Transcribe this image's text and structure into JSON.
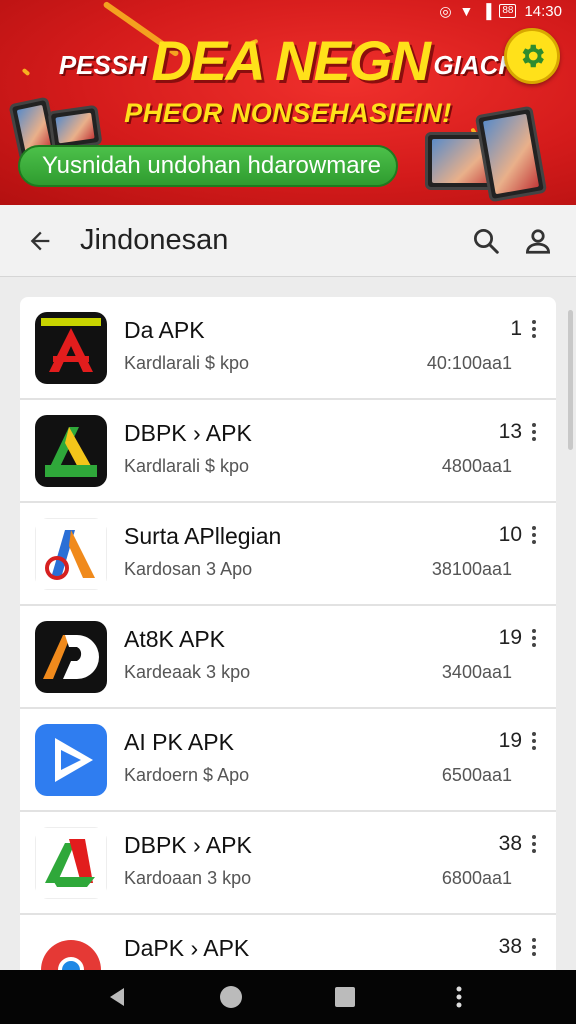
{
  "status_bar": {
    "time": "14:30",
    "battery": "88"
  },
  "banner": {
    "title_left": "PESSH",
    "title_main": "DEA NEGN",
    "title_right": "GIACH",
    "subtitle": "PHEOR NONSEHASIEIN!",
    "cta_label": "Yusnidah undohan hdarowmare",
    "colors": {
      "background": "#d41b1b",
      "headline": "#ffe11a",
      "cta": "#3aae3a"
    }
  },
  "app_bar": {
    "title": "Jindonesan"
  },
  "apps": [
    {
      "name": "Da APK",
      "meta": "Kardlarali $ kpo",
      "size": "40:100aa1",
      "count": "1",
      "icon": "red-a-black-icon"
    },
    {
      "name": "DBPK › APK",
      "meta": "Kardlarali $ kpo",
      "size": "4800aa1",
      "count": "13",
      "icon": "green-a-black-icon"
    },
    {
      "name": "Surta APllegian",
      "meta": "Kardosan 3 Apo",
      "size": "38100aa1",
      "count": "10",
      "icon": "colorful-a-icon"
    },
    {
      "name": "At8K APK",
      "meta": "Kardeaak 3 kpo",
      "size": "3400aa1",
      "count": "19",
      "icon": "ad-black-icon"
    },
    {
      "name": "AI PK APK",
      "meta": "Kardoern $ Apo",
      "size": "6500aa1",
      "count": "19",
      "icon": "blue-play-icon"
    },
    {
      "name": "DBPK › APK",
      "meta": "Kardoaan 3 kpo",
      "size": "6800aa1",
      "count": "38",
      "icon": "green-red-a-icon"
    },
    {
      "name": "DaPK › APK",
      "meta": "",
      "size": "",
      "count": "38",
      "icon": "chrome-like-icon"
    }
  ]
}
